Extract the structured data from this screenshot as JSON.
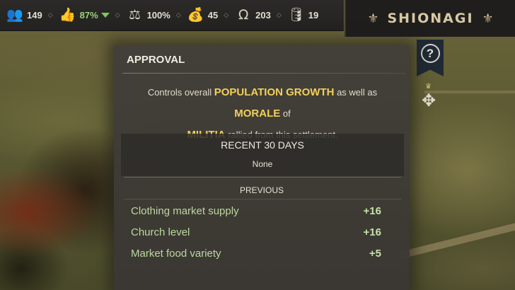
{
  "resources": [
    {
      "icon": "population-icon",
      "glyph": "👥",
      "value": "149"
    },
    {
      "icon": "approval-thumb-icon",
      "glyph": "👍",
      "value": "87%",
      "trend": "down"
    },
    {
      "icon": "scales-icon",
      "glyph": "⚖",
      "value": "100%"
    },
    {
      "icon": "money-icon",
      "glyph": "💰",
      "value": "45"
    },
    {
      "icon": "horseshoe-icon",
      "glyph": "Ω",
      "value": "203"
    },
    {
      "icon": "barrel-icon",
      "glyph": "🛢",
      "value": "19"
    }
  ],
  "settlement": {
    "name": "SHIONAGI",
    "ornament": "⚜"
  },
  "help_glyph": "?",
  "panel": {
    "title": "APPROVAL",
    "description": {
      "p1": "Controls overall ",
      "h1": "POPULATION GROWTH",
      "p2": " as well as ",
      "h2": "MORALE",
      "p3": " of ",
      "h3": "MILITIA",
      "p4": " rallied from this settlement."
    },
    "recent": {
      "title": "RECENT 30 DAYS",
      "value": "None"
    },
    "previous": {
      "title": "PREVIOUS",
      "rows": [
        {
          "label": "Clothing market supply",
          "amount": "+16"
        },
        {
          "label": "Church level",
          "amount": "+16"
        },
        {
          "label": "Market food variety",
          "amount": "+5"
        }
      ]
    }
  },
  "colors": {
    "highlight": "#f2d05a",
    "positive": "#bcd89e",
    "approval_green": "#9fd07a"
  }
}
